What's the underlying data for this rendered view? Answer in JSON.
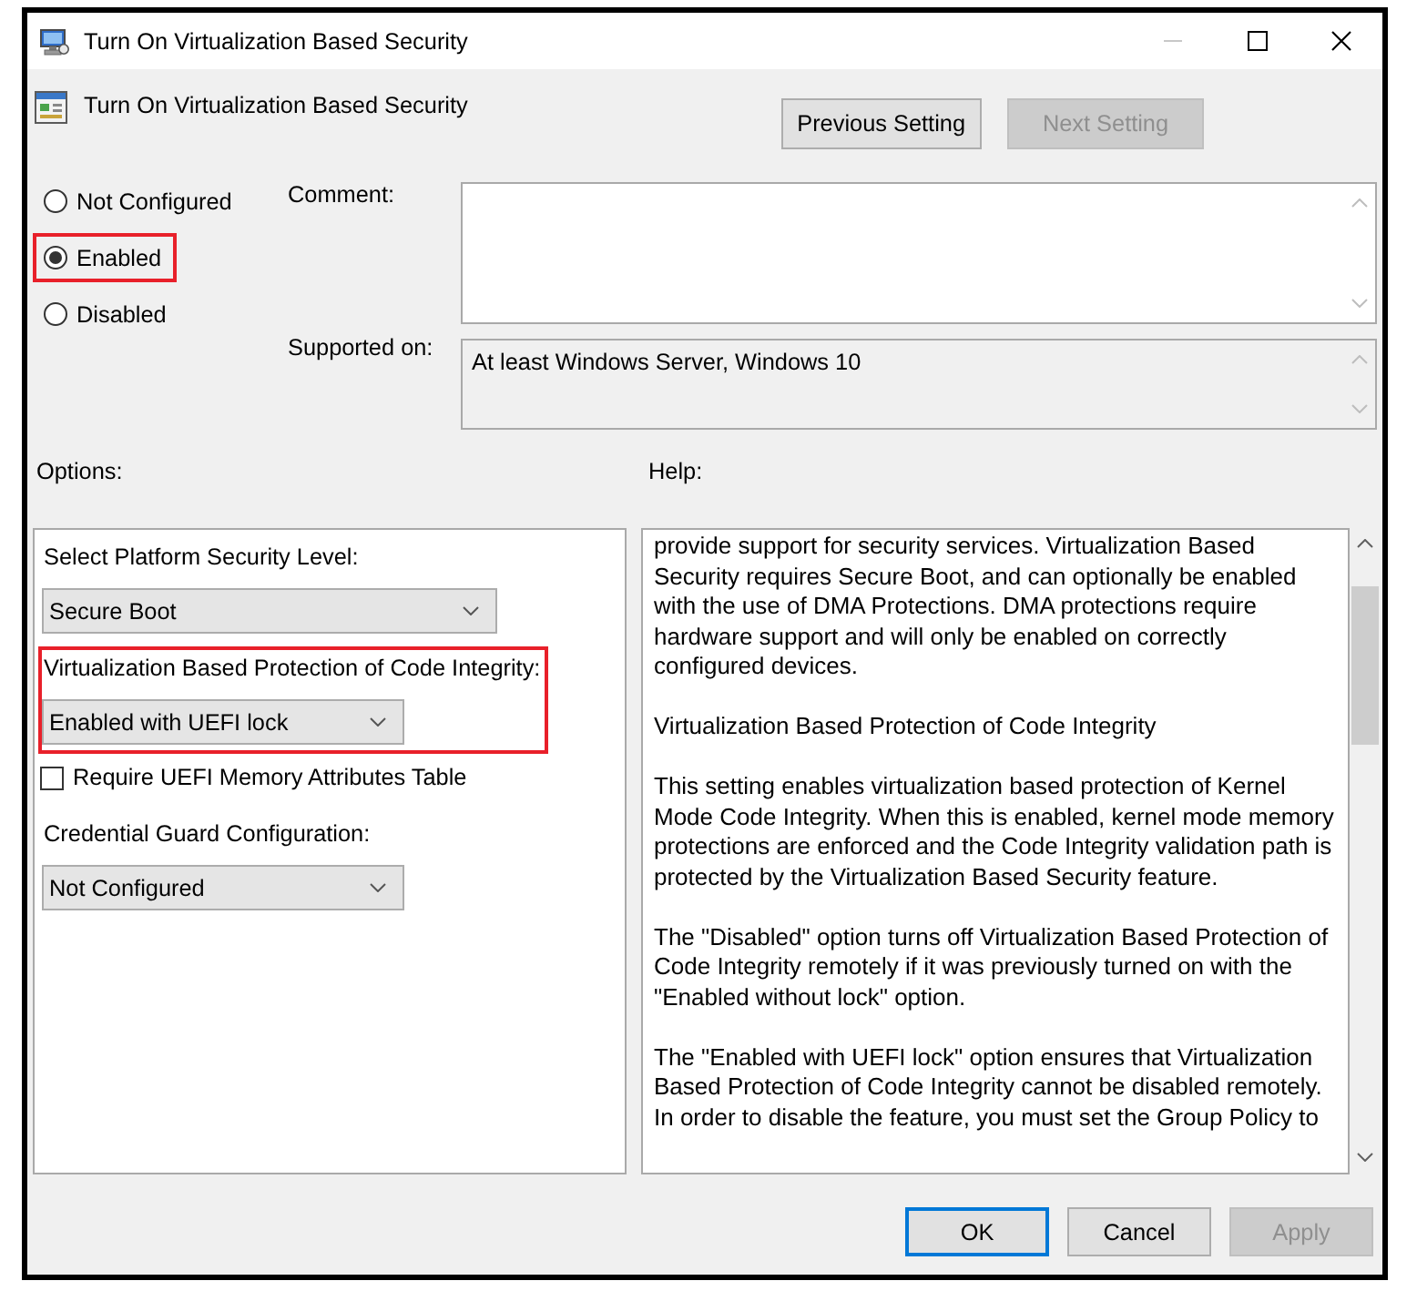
{
  "window": {
    "title": "Turn On Virtualization Based Security",
    "controls": [
      {
        "kind": "minimize",
        "disabled": true
      },
      {
        "kind": "maximize",
        "disabled": false
      },
      {
        "kind": "close",
        "disabled": false
      }
    ]
  },
  "header": {
    "title": "Turn On Virtualization Based Security",
    "buttons": [
      {
        "label": "Previous Setting",
        "disabled": false
      },
      {
        "label": "Next Setting",
        "disabled": true
      }
    ]
  },
  "state": {
    "options": [
      {
        "label": "Not Configured",
        "selected": false,
        "highlighted": false
      },
      {
        "label": "Enabled",
        "selected": true,
        "highlighted": true
      },
      {
        "label": "Disabled",
        "selected": false,
        "highlighted": false
      }
    ]
  },
  "comment": {
    "label": "Comment:"
  },
  "supported_on": {
    "label": "Supported on:",
    "value": "At least Windows Server, Windows 10"
  },
  "options": {
    "label": "Options:",
    "items": [
      {
        "kind": "dropdown",
        "label": "Select Platform Security Level:",
        "value": "Secure Boot",
        "highlighted": false
      },
      {
        "kind": "dropdown",
        "label": "Virtualization Based Protection of Code Integrity:",
        "value": "Enabled with UEFI lock",
        "highlighted": true
      },
      {
        "kind": "checkbox",
        "label": "Require UEFI Memory Attributes Table",
        "checked": false
      },
      {
        "kind": "dropdown",
        "label": "Credential Guard Configuration:",
        "value": "Not Configured",
        "highlighted": false
      }
    ]
  },
  "help": {
    "label": "Help:",
    "paragraphs": [
      "provide support for security services. Virtualization Based Security requires Secure Boot, and can optionally be enabled with the use of DMA Protections. DMA protections require hardware support and will only be enabled on correctly configured devices.",
      "Virtualization Based Protection of Code Integrity",
      "This setting enables virtualization based protection of Kernel Mode Code Integrity. When this is enabled, kernel mode memory protections are enforced and the Code Integrity validation path is protected by the Virtualization Based Security feature.",
      "The \"Disabled\" option turns off Virtualization Based Protection of Code Integrity remotely if it was previously turned on with the \"Enabled without lock\" option.",
      "The \"Enabled with UEFI lock\" option ensures that Virtualization Based Protection of Code Integrity cannot be disabled remotely. In order to disable the feature, you must set the Group Policy to"
    ]
  },
  "buttons": [
    {
      "label": "OK",
      "focused": true,
      "disabled": false
    },
    {
      "label": "Cancel",
      "focused": false,
      "disabled": false
    },
    {
      "label": "Apply",
      "focused": false,
      "disabled": true
    }
  ]
}
